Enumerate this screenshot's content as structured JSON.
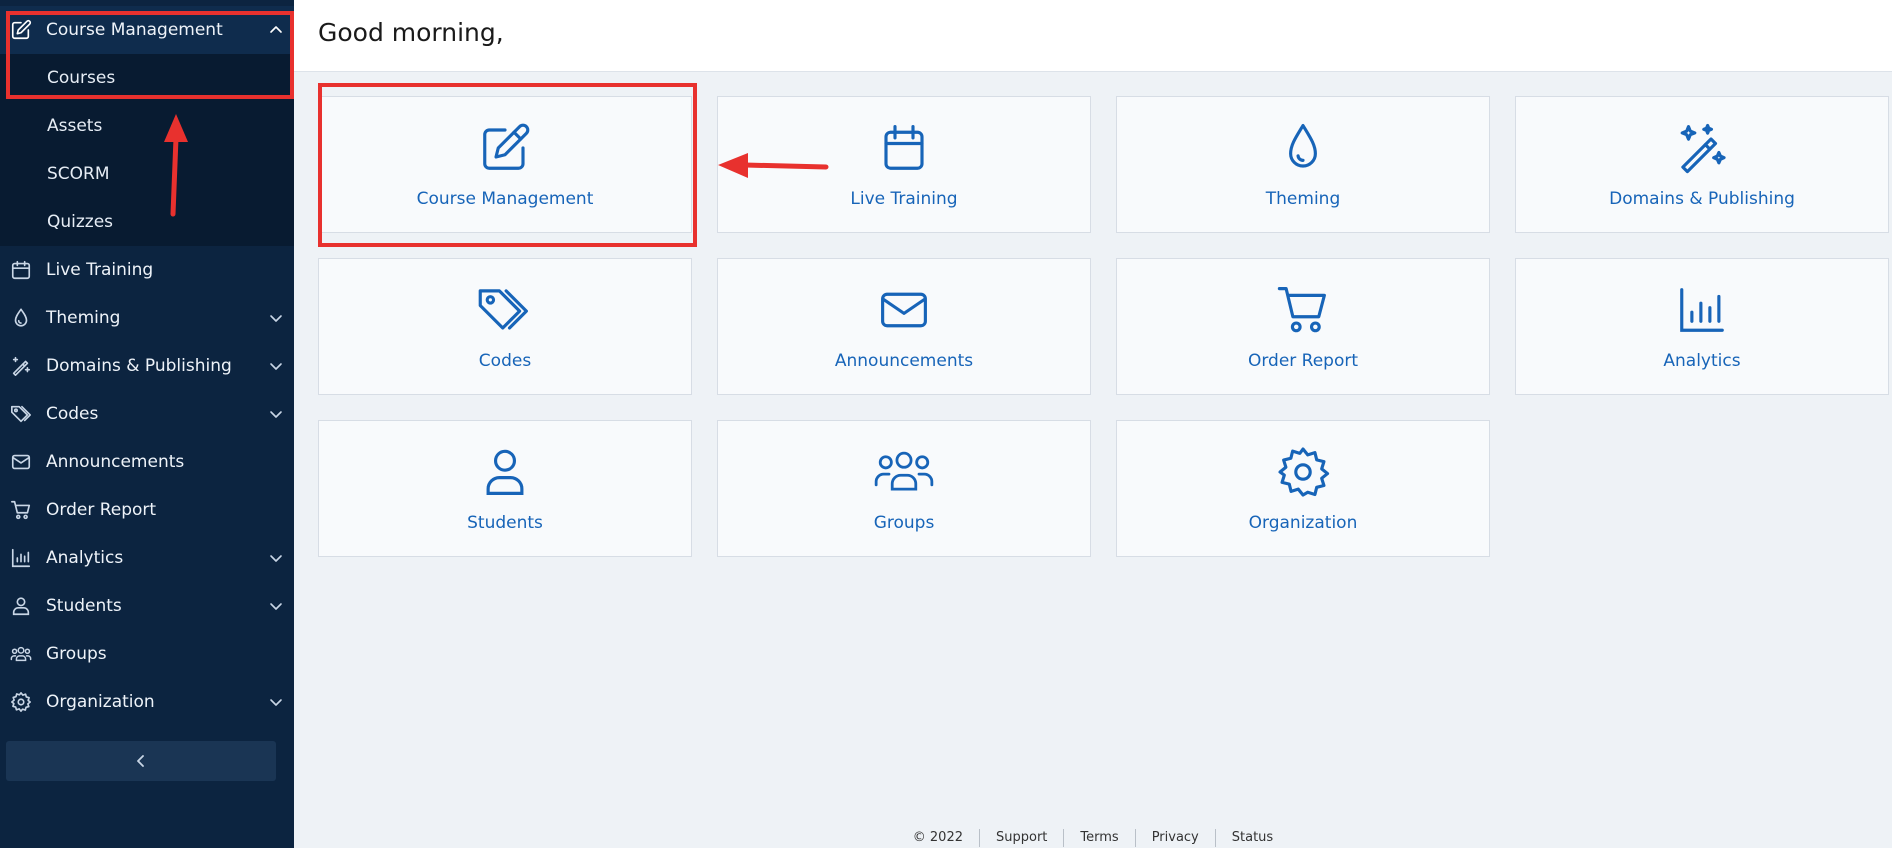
{
  "sidebar": {
    "items": [
      {
        "label": "Course Management",
        "icon": "edit-icon",
        "expanded": true
      },
      {
        "label": "Live Training",
        "icon": "calendar-icon"
      },
      {
        "label": "Theming",
        "icon": "droplet-icon"
      },
      {
        "label": "Domains & Publishing",
        "icon": "magic-wand-icon"
      },
      {
        "label": "Codes",
        "icon": "tags-icon"
      },
      {
        "label": "Announcements",
        "icon": "envelope-icon"
      },
      {
        "label": "Order Report",
        "icon": "cart-icon"
      },
      {
        "label": "Analytics",
        "icon": "bar-chart-icon"
      },
      {
        "label": "Students",
        "icon": "user-icon"
      },
      {
        "label": "Groups",
        "icon": "users-icon"
      },
      {
        "label": "Organization",
        "icon": "gear-icon"
      }
    ],
    "subitems": [
      {
        "label": "Courses"
      },
      {
        "label": "Assets"
      },
      {
        "label": "SCORM"
      },
      {
        "label": "Quizzes"
      }
    ]
  },
  "header": {
    "greeting": "Good morning,"
  },
  "tiles": [
    {
      "label": "Course Management",
      "icon": "edit-icon"
    },
    {
      "label": "Live Training",
      "icon": "calendar-icon"
    },
    {
      "label": "Theming",
      "icon": "droplet-icon"
    },
    {
      "label": "Domains & Publishing",
      "icon": "magic-wand-icon"
    },
    {
      "label": "Codes",
      "icon": "tags-icon"
    },
    {
      "label": "Announcements",
      "icon": "envelope-icon"
    },
    {
      "label": "Order Report",
      "icon": "cart-icon"
    },
    {
      "label": "Analytics",
      "icon": "bar-chart-icon"
    },
    {
      "label": "Students",
      "icon": "user-icon"
    },
    {
      "label": "Groups",
      "icon": "users-icon"
    },
    {
      "label": "Organization",
      "icon": "gear-icon"
    }
  ],
  "footer": {
    "copyright": "© 2022",
    "links": [
      "Support",
      "Terms",
      "Privacy",
      "Status"
    ]
  },
  "colors": {
    "sidebar_bg": "#0c2440",
    "accent": "#1764b8",
    "annotation": "#e8312e"
  }
}
